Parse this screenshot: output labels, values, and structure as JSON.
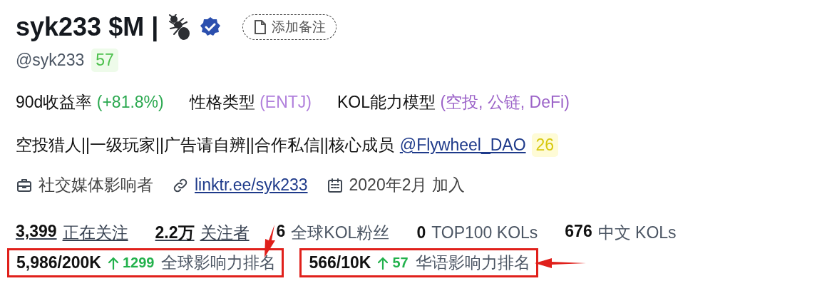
{
  "profile": {
    "name": "syk233 $M |",
    "verified": true,
    "note_button": "添加备注",
    "handle": "@syk233",
    "handle_score": "57"
  },
  "traits": [
    {
      "label": "90d收益率",
      "value": "(+81.8%)",
      "color": "#2aa84f"
    },
    {
      "label": "性格类型",
      "value": "(ENTJ)",
      "color": "#b07fdc"
    },
    {
      "label": "KOL能力模型",
      "value": "(空投, 公链, DeFi)",
      "color": "#9b62c8"
    }
  ],
  "bio": {
    "text": "空投猎人||一级玩家||广告请自辨||合作私信||核心成员",
    "mention": "@Flywheel_DAO",
    "mention_score": "26"
  },
  "meta": [
    {
      "kind": "category",
      "text": "社交媒体影响者"
    },
    {
      "kind": "link",
      "text": "linktr.ee/syk233"
    },
    {
      "kind": "joined",
      "text": "2020年2月 加入"
    }
  ],
  "counts": [
    {
      "kind": "link",
      "number": "3,399",
      "text": "正在关注"
    },
    {
      "kind": "link",
      "number": "2.2万",
      "text": "关注者"
    },
    {
      "kind": "stat",
      "number": "6",
      "text": "全球KOL粉丝"
    },
    {
      "kind": "stat",
      "number": "0",
      "text": "TOP100 KOLs"
    },
    {
      "kind": "stat",
      "number": "676",
      "text": "中文 KOLs"
    }
  ],
  "rankings": [
    {
      "rank": "5,986/200K",
      "change": "1299",
      "title": "全球影响力排名",
      "highlighted": true,
      "kind": "down-arrow"
    },
    {
      "rank": "566/10K",
      "change": "57",
      "title": "华语影响力排名",
      "highlighted": true,
      "kind": "left-arrow"
    }
  ]
}
